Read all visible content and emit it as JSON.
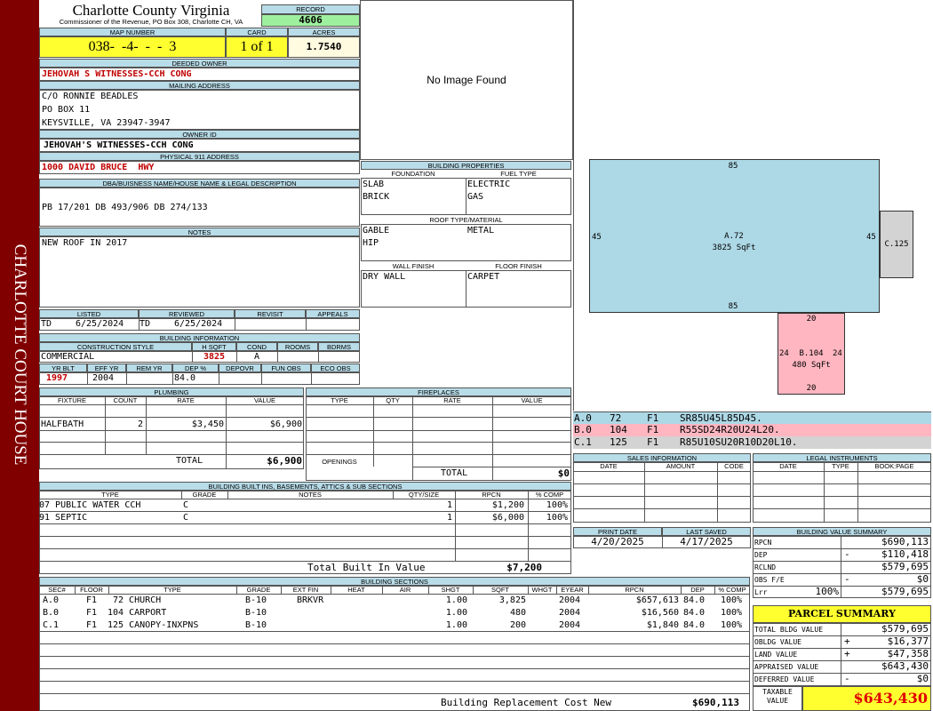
{
  "sidebar": {
    "title": "CHARLOTTE COURT HOUSE"
  },
  "header": {
    "county": "Charlotte County Virginia",
    "subtitle": "Commissioner of the Revenue, PO Box 308, Charlotte CH, VA",
    "record_label": "RECORD",
    "record": "4606"
  },
  "parcel": {
    "map_label": "MAP NUMBER",
    "map_number": "038-  -4-  -  -  3",
    "card_label": "CARD",
    "card": "1 of 1",
    "acres_label": "ACRES",
    "acres": "1.7540",
    "owner_label": "DEEDED OWNER",
    "owner": "JEHOVAH S WITNESSES-CCH CONG",
    "mailing_label": "MAILING ADDRESS",
    "mail1": "C/O RONNIE BEADLES",
    "mail2": "PO BOX 11",
    "mail3": "KEYSVILLE, VA 23947-3947",
    "ownerid_label": "OWNER ID",
    "ownerid": "JEHOVAH'S WITNESSES-CCH CONG",
    "address_label": "PHYSICAL 911 ADDRESS",
    "address": "1000 DAVID BRUCE  HWY",
    "legal_label": "DBA/BUISNESS NAME/HOUSE NAME & LEGAL DESCRIPTION",
    "legal": "PB 17/201 DB 493/906 DB 274/133",
    "notes_label": "NOTES",
    "notes": "NEW ROOF IN 2017"
  },
  "listing": {
    "listed_label": "LISTED",
    "listed_by": "TD",
    "listed_date": "6/25/2024",
    "reviewed_label": "REVIEWED",
    "reviewed_by": "TD",
    "reviewed_date": "6/25/2024",
    "revisit_label": "REVISIT",
    "appeals_label": "APPEALS"
  },
  "building_info": {
    "title": "BUILDING INFORMATION",
    "style_label": "CONSTRUCTION STYLE",
    "style": "COMMERCIAL",
    "hsqft_label": "H SQFT",
    "hsqft": "3825",
    "cond_label": "COND",
    "cond": "A",
    "rooms_label": "ROOMS",
    "bdrms_label": "BDRMS",
    "yrblt_label": "YR BLT",
    "yrblt": "1997",
    "effyr_label": "EFF YR",
    "effyr": "2004",
    "remyr_label": "REM YR",
    "dep_label": "DEP %",
    "dep": "84.0",
    "depovr_label": "DEPOVR",
    "funobs_label": "FUN OBS",
    "ecoobs_label": "ECO OBS"
  },
  "image": {
    "no_image": "No Image Found"
  },
  "building_properties": {
    "title": "BUILDING PROPERTIES",
    "foundation_label": "FOUNDATION",
    "foundation1": "SLAB",
    "foundation2": "BRICK",
    "fuel_label": "FUEL TYPE",
    "fuel1": "ELECTRIC",
    "fuel2": "GAS",
    "roof_label": "ROOF TYPE/MATERIAL",
    "roof1": "GABLE",
    "roof2": "HIP",
    "roof3": "METAL",
    "wall_label": "WALL FINISH",
    "wall": "DRY WALL",
    "floor_label": "FLOOR FINISH",
    "floor": "CARPET"
  },
  "sketch": {
    "a_top": "85",
    "a_bottom": "85",
    "a_left": "45",
    "a_right": "45",
    "a_label": "A.72",
    "a_area": "3825 SqFt",
    "b_top": "20",
    "b_bottom": "20",
    "b_left": "24",
    "b_right": "24",
    "b_label": "B.104",
    "b_area": "480 SqFt",
    "c_label": "C.125",
    "colors": {
      "a": "#add8e6",
      "b": "#ffb6c1",
      "c": "#d3d3d3"
    },
    "legend": [
      {
        "sec": "A.0",
        "code": "72",
        "floor": "F1",
        "desc": "SR85U45L85D45."
      },
      {
        "sec": "B.0",
        "code": "104",
        "floor": "F1",
        "desc": "R55SD24R20U24L20."
      },
      {
        "sec": "C.1",
        "code": "125",
        "floor": "F1",
        "desc": "R85U10SU20R10D20L10."
      }
    ]
  },
  "plumbing": {
    "title": "PLUMBING",
    "headers": [
      "FIXTURE",
      "COUNT",
      "RATE",
      "VALUE"
    ],
    "row": {
      "fixture": "HALFBATH",
      "count": "2",
      "rate": "$3,450",
      "value": "$6,900"
    },
    "total_label": "TOTAL",
    "total": "$6,900"
  },
  "fireplaces": {
    "title": "FIREPLACES",
    "headers": [
      "TYPE",
      "QTY",
      "RATE",
      "VALUE"
    ],
    "openings_label": "OPENINGS",
    "total_label": "TOTAL",
    "total": "$0"
  },
  "sales": {
    "title": "SALES INFORMATION",
    "headers": [
      "DATE",
      "AMOUNT",
      "CODE"
    ]
  },
  "legal_instruments": {
    "title": "LEGAL INSTRUMENTS",
    "headers": [
      "DATE",
      "TYPE",
      "BOOK:PAGE"
    ]
  },
  "dates": {
    "print_label": "PRINT DATE",
    "print": "4/20/2025",
    "saved_label": "LAST SAVED",
    "saved": "4/17/2025"
  },
  "builtins": {
    "title": "BUILDING BUILT INS, BASEMENTS, ATTICS & SUB SECTIONS",
    "headers": [
      "TYPE",
      "GRADE",
      "NOTES",
      "QTY/SIZE",
      "RPCN",
      "% COMP"
    ],
    "rows": [
      {
        "type": "07 PUBLIC WATER CCH",
        "grade": "C",
        "qty": "1",
        "rpcn": "$1,200",
        "comp": "100%"
      },
      {
        "type": "91 SEPTIC",
        "grade": "C",
        "qty": "1",
        "rpcn": "$6,000",
        "comp": "100%"
      }
    ],
    "total_label": "Total Built In Value",
    "total": "$7,200"
  },
  "value_summary": {
    "title": "BUILDING VALUE SUMMARY",
    "rpcn_label": "RPCN",
    "rpcn": "$690,113",
    "dep_label": "DEP",
    "dep_sign": "-",
    "dep": "$110,418",
    "rclnd_label": "RCLND",
    "rclnd": "$579,695",
    "obs_label": "OBS F/E",
    "obs_sign": "-",
    "obs": "$0",
    "lrr_label": "Lrr",
    "lrr_pct": "100%",
    "lrr": "$579,695"
  },
  "sections": {
    "title": "BUILDING SECTIONS",
    "headers": [
      "SEC#",
      "FLOOR",
      "TYPE",
      "GRADE",
      "EXT FIN",
      "HEAT",
      "AIR",
      "SHGT",
      "SQFT",
      "WHGT",
      "EYEAR",
      "RPCN",
      "DEP",
      "% COMP"
    ],
    "rows": [
      {
        "sec": "A.0",
        "floor": "F1",
        "type": "72 CHURCH",
        "grade": "B-10",
        "ext": "BRKVR",
        "shgt": "1.00",
        "sqft": "3,825",
        "eyear": "2004",
        "rpcn": "$657,613",
        "dep": "84.0",
        "comp": "100%"
      },
      {
        "sec": "B.0",
        "floor": "F1",
        "type": "104 CARPORT",
        "grade": "B-10",
        "ext": "",
        "shgt": "1.00",
        "sqft": "480",
        "eyear": "2004",
        "rpcn": "$16,560",
        "dep": "84.0",
        "comp": "100%"
      },
      {
        "sec": "C.1",
        "floor": "F1",
        "type": "125 CANOPY-INXPNS",
        "grade": "B-10",
        "ext": "",
        "shgt": "1.00",
        "sqft": "200",
        "eyear": "2004",
        "rpcn": "$1,840",
        "dep": "84.0",
        "comp": "100%"
      }
    ],
    "total_label": "Building Replacement Cost New",
    "total": "$690,113"
  },
  "parcel_summary": {
    "title": "PARCEL SUMMARY",
    "bldg_label": "TOTAL BLDG VALUE",
    "bldg": "$579,695",
    "obldg_label": "OBLDG VALUE",
    "obldg_sign": "+",
    "obldg": "$16,377",
    "land_label": "LAND VALUE",
    "land_sign": "+",
    "land": "$47,358",
    "appraised_label": "APPRAISED VALUE",
    "appraised": "$643,430",
    "deferred_label": "DEFERRED VALUE",
    "deferred_sign": "-",
    "deferred": "$0",
    "taxable_label1": "TAXABLE",
    "taxable_label2": "VALUE",
    "taxable": "$643,430"
  }
}
